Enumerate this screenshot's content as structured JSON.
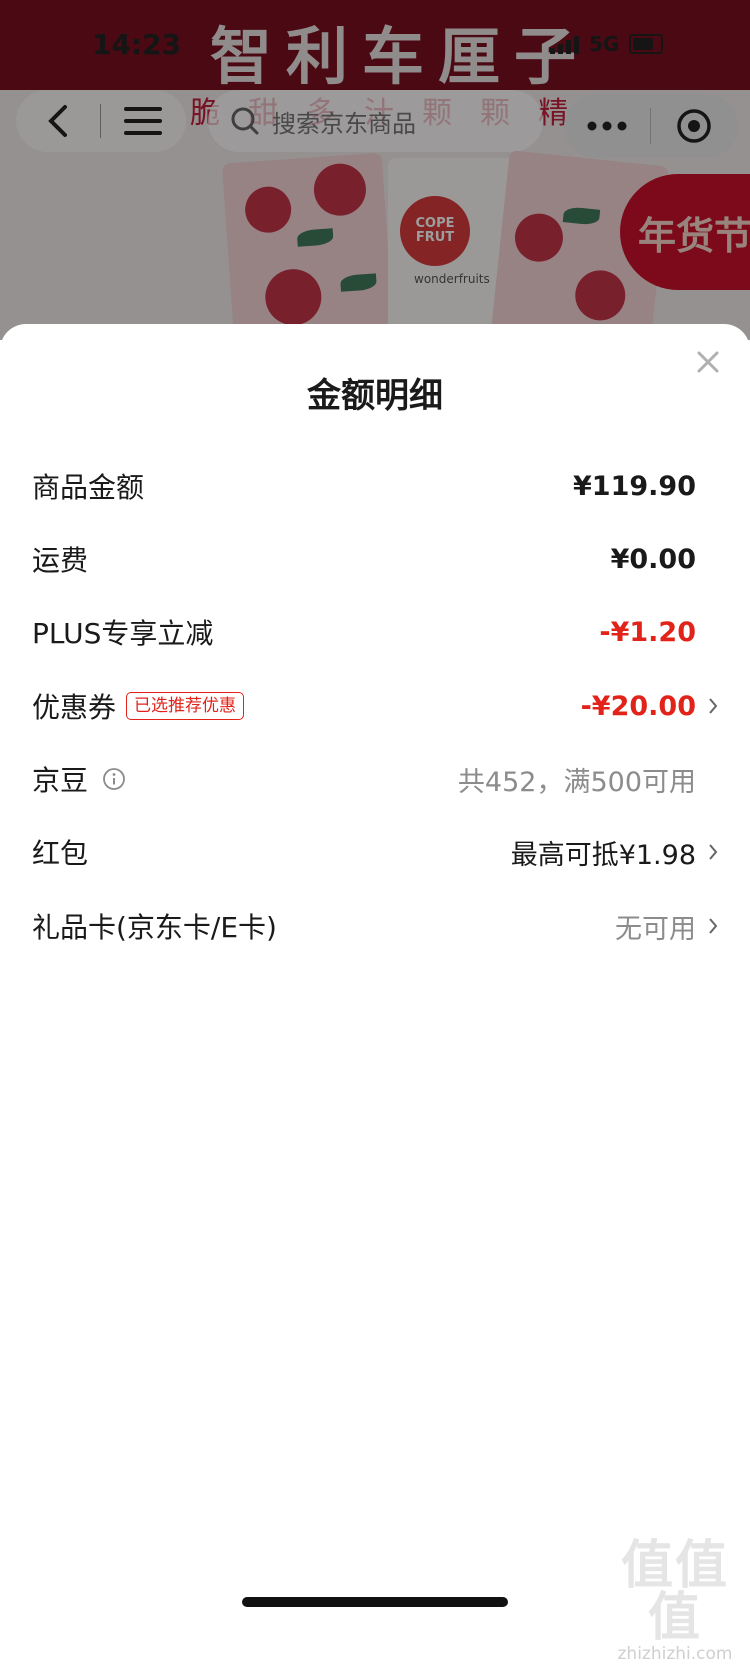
{
  "status_bar": {
    "time": "14:23",
    "network": "5G"
  },
  "banner": {
    "title": "智利车厘子",
    "subtitle": "脆甜多汁颗颗精选"
  },
  "nav": {
    "search_placeholder": "搜索京东商品"
  },
  "product": {
    "brand": "COPE FRUT",
    "tagline": "wonderfruits",
    "badge": "年货节"
  },
  "sheet": {
    "title": "金额明细",
    "rows": [
      {
        "label": "商品金额",
        "value": "¥119.90"
      },
      {
        "label": "运费",
        "value": "¥0.00"
      },
      {
        "label": "PLUS专享立减",
        "value": "-¥1.20"
      },
      {
        "label": "优惠券",
        "tag": "已选推荐优惠",
        "value": "-¥20.00"
      },
      {
        "label": "京豆",
        "value": "共452，满500可用"
      },
      {
        "label": "红包",
        "value": "最高可抵¥1.98"
      },
      {
        "label": "礼品卡(京东卡/E卡)",
        "value": "无可用"
      }
    ]
  },
  "watermark": {
    "big": "值值值",
    "small": "zhizhizhi.com"
  },
  "colors": {
    "accent_red": "#e2231a",
    "banner_red": "#7a0f1f"
  }
}
